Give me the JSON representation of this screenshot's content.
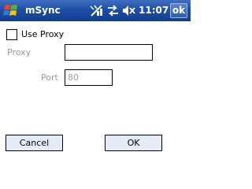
{
  "titlebar": {
    "app_title": "mSync",
    "clock": "11:07",
    "ok_label": "ok",
    "icons": [
      "windows-start-icon",
      "signal-icon",
      "sync-icon",
      "volume-icon"
    ]
  },
  "form": {
    "use_proxy_label": "Use Proxy",
    "use_proxy_checked": false,
    "proxy_label": "Proxy",
    "proxy_value": "",
    "port_label": "Port",
    "port_value": "80"
  },
  "buttons": {
    "cancel_label": "Cancel",
    "ok_label": "OK"
  },
  "colors": {
    "titlebar": "#1d4fa6",
    "disabled_text": "#9a9a9a",
    "button_bg": "#e4ecf7"
  }
}
